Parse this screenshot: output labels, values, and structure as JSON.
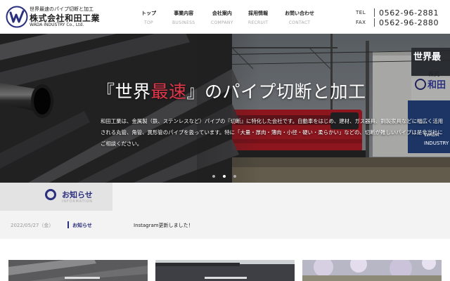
{
  "header": {
    "logo_tagline": "世界最速のパイプ切断と加工",
    "company_name": "株式会社和田工業",
    "company_name_en": "WADA INDUSTRY Co., Ltd.",
    "logo_icon": "w-circle-logo",
    "brand_color": "#2a2f7e"
  },
  "nav": [
    {
      "label": "トップ",
      "sub": "TOP"
    },
    {
      "label": "事業内容",
      "sub": "BUSINESS"
    },
    {
      "label": "会社案内",
      "sub": "COMPANY"
    },
    {
      "label": "採用情報",
      "sub": "RECRUIT"
    },
    {
      "label": "お問い合わせ",
      "sub": "CONTACT"
    }
  ],
  "contact": {
    "tel_label": "TEL",
    "tel": "0562-96-2881",
    "fax_label": "FAX",
    "fax": "0562-96-2880"
  },
  "hero": {
    "title_before": "『世界",
    "title_accent": "最速",
    "title_after": "』のパイプ切断と加工",
    "accent_color": "#e0364a",
    "description": "和田工業は、金属製（鉄、ステンレスなど）パイプの『切断』に特化した会社です。自動車をはじめ、建材、ガス器具、鋼製家具などに幅広く活用される丸管、角管、異形管のパイプを扱っています。特に「大量・厚肉・薄肉・小径・硬い・柔らかい」などの、切断が難しいパイプは是非当社にご相談ください。",
    "slide_count": 3,
    "active_slide": 1,
    "sign_text": "世界最",
    "sign_small": "株式",
    "sign_brand": "和田",
    "panel_text_1": "WADA",
    "panel_text_2": "INDUSTRY"
  },
  "news": {
    "title": "お知らせ",
    "title_en": "INFORMATION",
    "items": [
      {
        "date": "2022/05/27（金）",
        "category": "お知らせ",
        "text": "Instagram更新しました！"
      }
    ]
  },
  "cards": [
    {
      "name": "business-card"
    },
    {
      "name": "company-card"
    },
    {
      "name": "recruit-card"
    }
  ]
}
